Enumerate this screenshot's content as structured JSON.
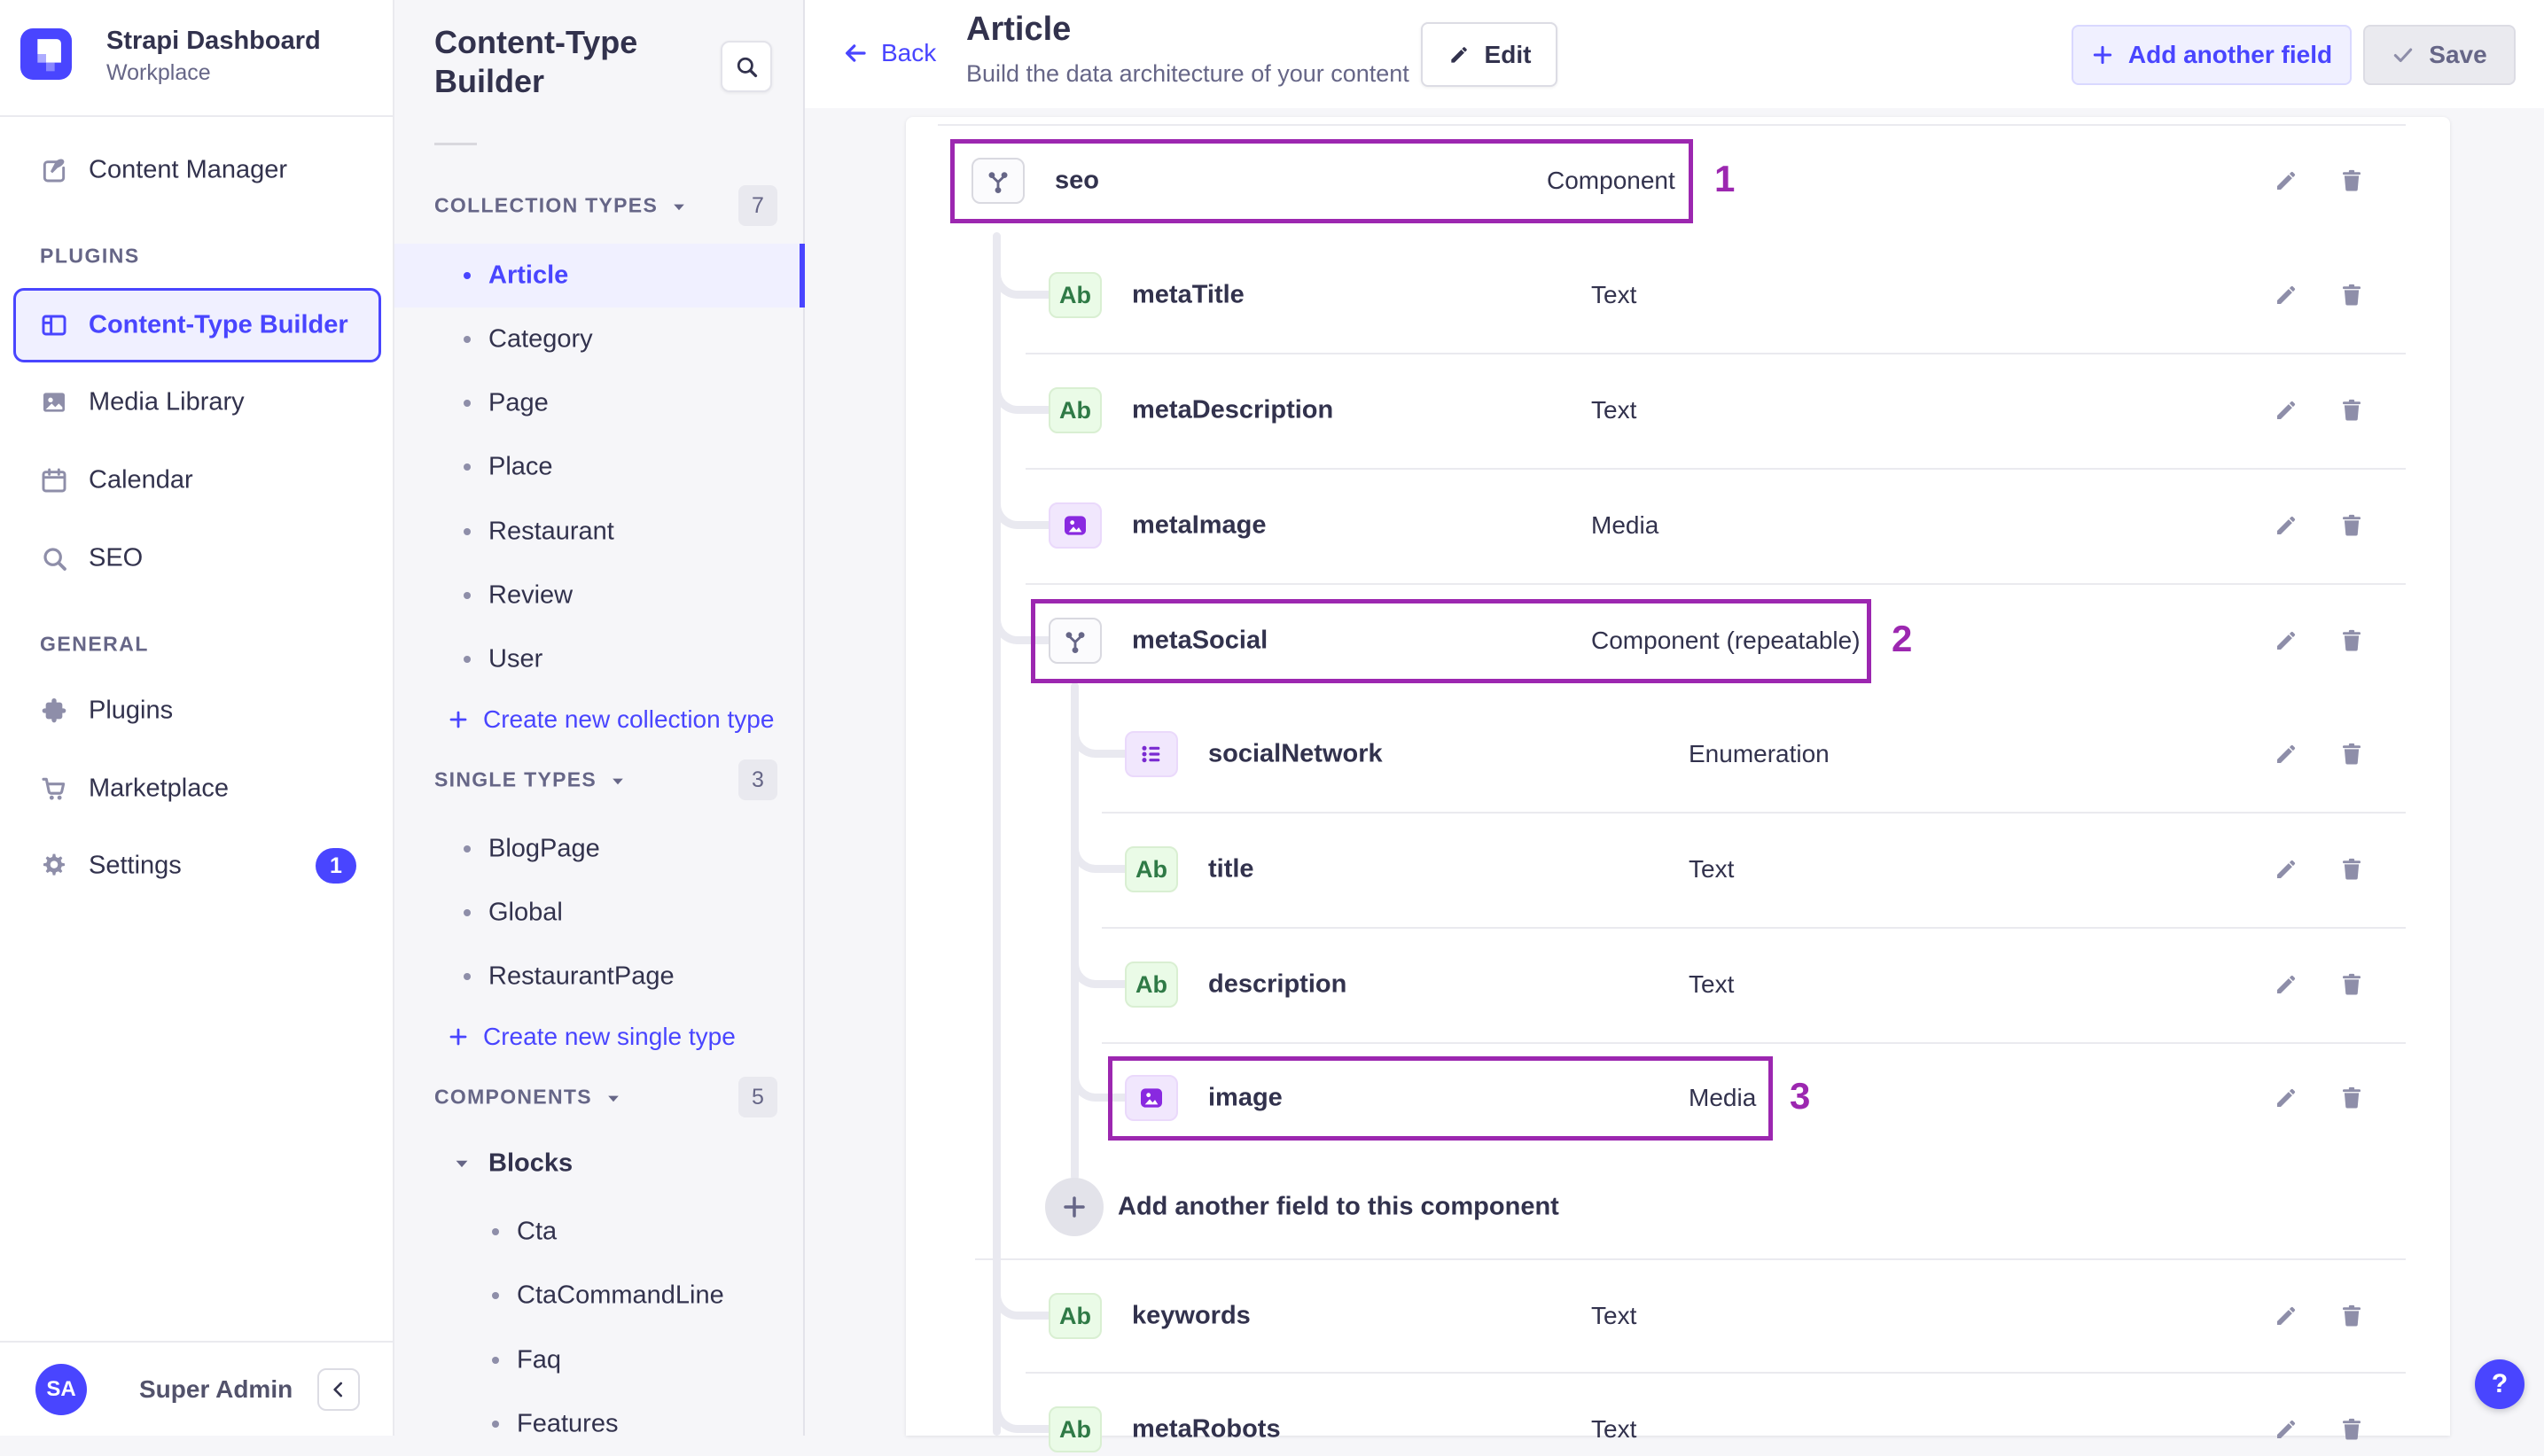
{
  "brand": {
    "title": "Strapi Dashboard",
    "subtitle": "Workplace"
  },
  "nav": {
    "content_manager": "Content Manager",
    "sections": [
      {
        "label": "PLUGINS",
        "items": [
          {
            "label": "Content-Type Builder",
            "icon": "layout",
            "active": true
          },
          {
            "label": "Media Library",
            "icon": "media"
          },
          {
            "label": "Calendar",
            "icon": "calendar"
          },
          {
            "label": "SEO",
            "icon": "search"
          }
        ]
      },
      {
        "label": "GENERAL",
        "items": [
          {
            "label": "Plugins",
            "icon": "puzzle"
          },
          {
            "label": "Marketplace",
            "icon": "cart"
          },
          {
            "label": "Settings",
            "icon": "gear",
            "badge": "1"
          }
        ]
      }
    ],
    "user": {
      "initials": "SA",
      "name": "Super Admin"
    }
  },
  "subnav": {
    "title": "Content-Type Builder",
    "groups": [
      {
        "label": "COLLECTION TYPES",
        "count": "7",
        "items": [
          "Article",
          "Category",
          "Page",
          "Place",
          "Restaurant",
          "Review",
          "User"
        ],
        "active_item": "Article",
        "action": "Create new collection type"
      },
      {
        "label": "SINGLE TYPES",
        "count": "3",
        "items": [
          "BlogPage",
          "Global",
          "RestaurantPage"
        ],
        "action": "Create new single type"
      },
      {
        "label": "COMPONENTS",
        "count": "5",
        "category": "Blocks",
        "items": [
          "Cta",
          "CtaCommandLine",
          "Faq",
          "Features"
        ]
      }
    ]
  },
  "header": {
    "back": "Back",
    "title": "Article",
    "subtitle": "Build the data architecture of your content",
    "edit": "Edit",
    "add_field": "Add another field",
    "save": "Save"
  },
  "content": {
    "fields": [
      {
        "name": "seo",
        "type": "Component",
        "icon": "component",
        "level": 0,
        "annotation": "1"
      },
      {
        "name": "metaTitle",
        "type": "Text",
        "icon": "text",
        "level": 1
      },
      {
        "name": "metaDescription",
        "type": "Text",
        "icon": "text",
        "level": 1
      },
      {
        "name": "metaImage",
        "type": "Media",
        "icon": "media",
        "level": 1
      },
      {
        "name": "metaSocial",
        "type": "Component (repeatable)",
        "icon": "component",
        "level": 1,
        "annotation": "2"
      },
      {
        "name": "socialNetwork",
        "type": "Enumeration",
        "icon": "enumeration",
        "level": 2
      },
      {
        "name": "title",
        "type": "Text",
        "icon": "text",
        "level": 2
      },
      {
        "name": "description",
        "type": "Text",
        "icon": "text",
        "level": 2
      },
      {
        "name": "image",
        "type": "Media",
        "icon": "media",
        "level": 2,
        "annotation": "3"
      },
      {
        "name": "keywords",
        "type": "Text",
        "icon": "text",
        "level": 1
      },
      {
        "name": "metaRobots",
        "type": "Text",
        "icon": "text",
        "level": 1
      }
    ],
    "add_component_field": "Add another field to this component"
  },
  "help_label": "?",
  "colors": {
    "primary": "#4945ff",
    "primary_light_bg": "#f0f0ff",
    "annotation_purple": "#9c27b0",
    "text_field_green": "#2f7a46",
    "media_field_purple": "#8929e0",
    "save_disabled_bg": "#eaeaef",
    "sidebar_bg": "#f6f6f9"
  }
}
